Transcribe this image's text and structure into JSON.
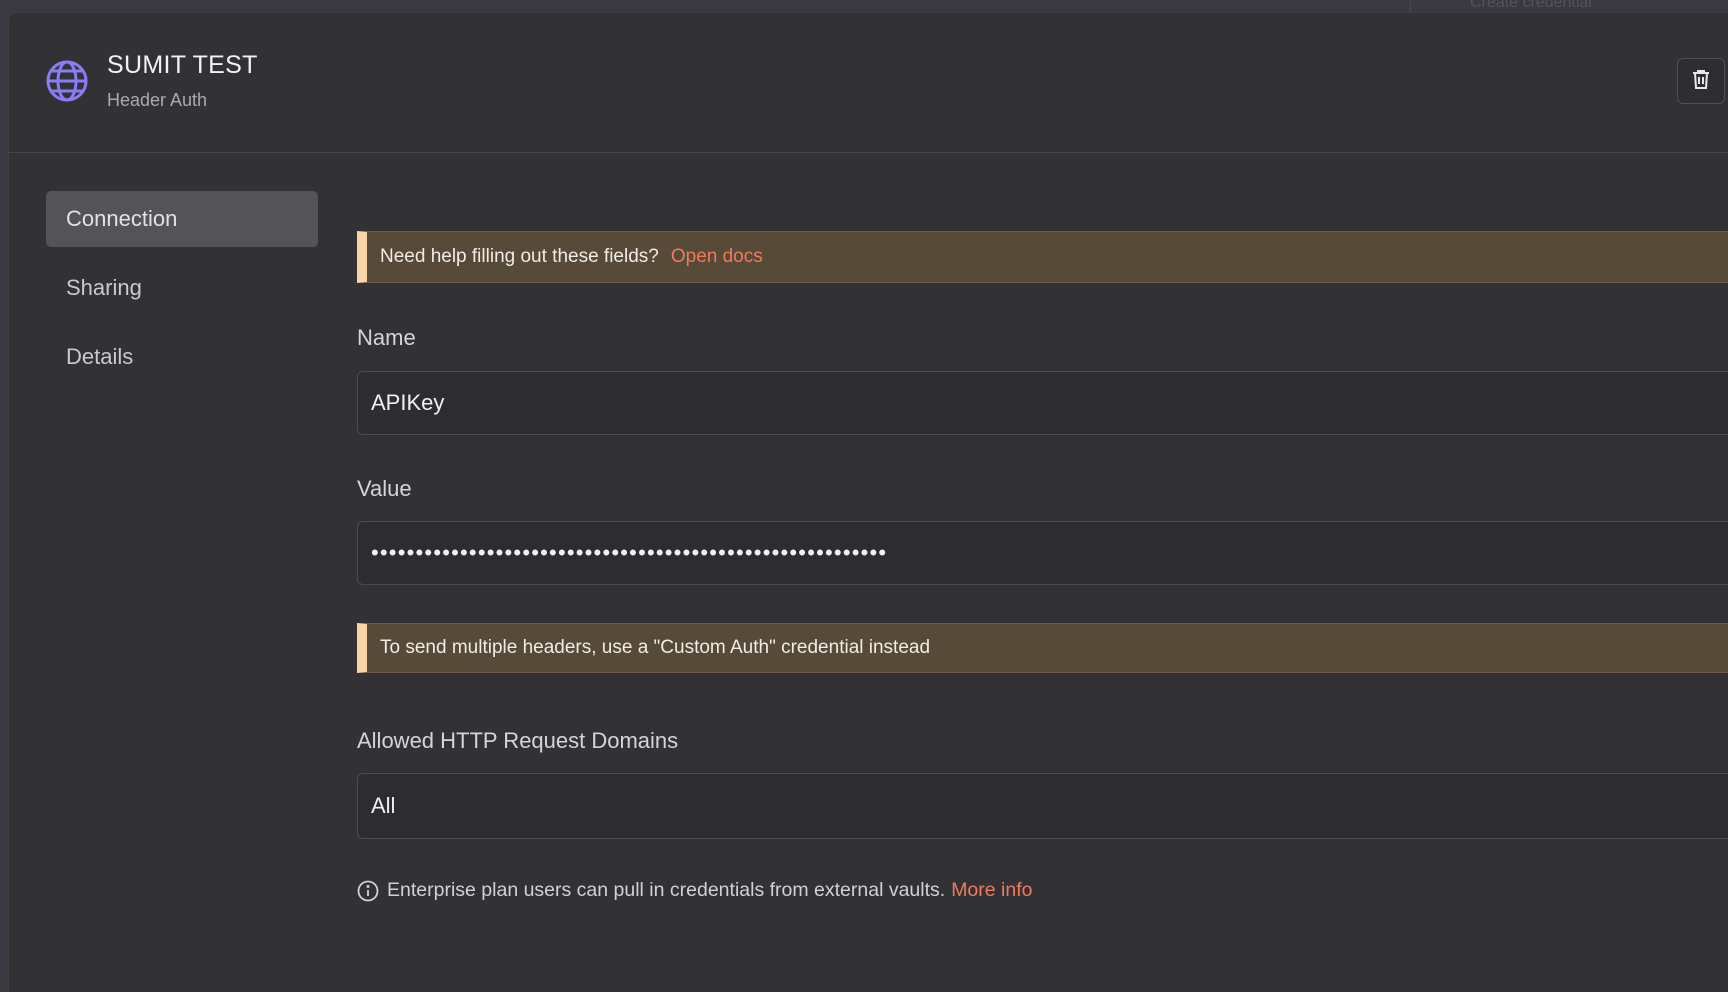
{
  "backdrop": {
    "ghost_text": "Create credential"
  },
  "header": {
    "title": "SUMIT TEST",
    "subtitle": "Header Auth"
  },
  "sidebar": {
    "items": [
      {
        "label": "Connection",
        "active": true
      },
      {
        "label": "Sharing",
        "active": false
      },
      {
        "label": "Details",
        "active": false
      }
    ]
  },
  "form": {
    "help_notice": {
      "text": "Need help filling out these fields?",
      "link": "Open docs"
    },
    "name": {
      "label": "Name",
      "value": "APIKey"
    },
    "value": {
      "label": "Value",
      "masked_value": "••••••••••••••••••••••••••••••••••••••••••••••••••••••••••"
    },
    "headers_notice": {
      "text": "To send multiple headers, use a \"Custom Auth\" credential instead"
    },
    "domains": {
      "label": "Allowed HTTP Request Domains",
      "value": "All"
    },
    "info": {
      "text": "Enterprise plan users can pull in credentials from external vaults.",
      "link": "More info"
    }
  },
  "colors": {
    "accent_link": "#ef7a5d",
    "notice_bg": "#574a39",
    "notice_bar": "#f7d5a5",
    "globe_icon": "#8b7cf6"
  },
  "icons": {
    "header": "globe-icon",
    "delete": "trash-icon",
    "info": "info-icon"
  }
}
